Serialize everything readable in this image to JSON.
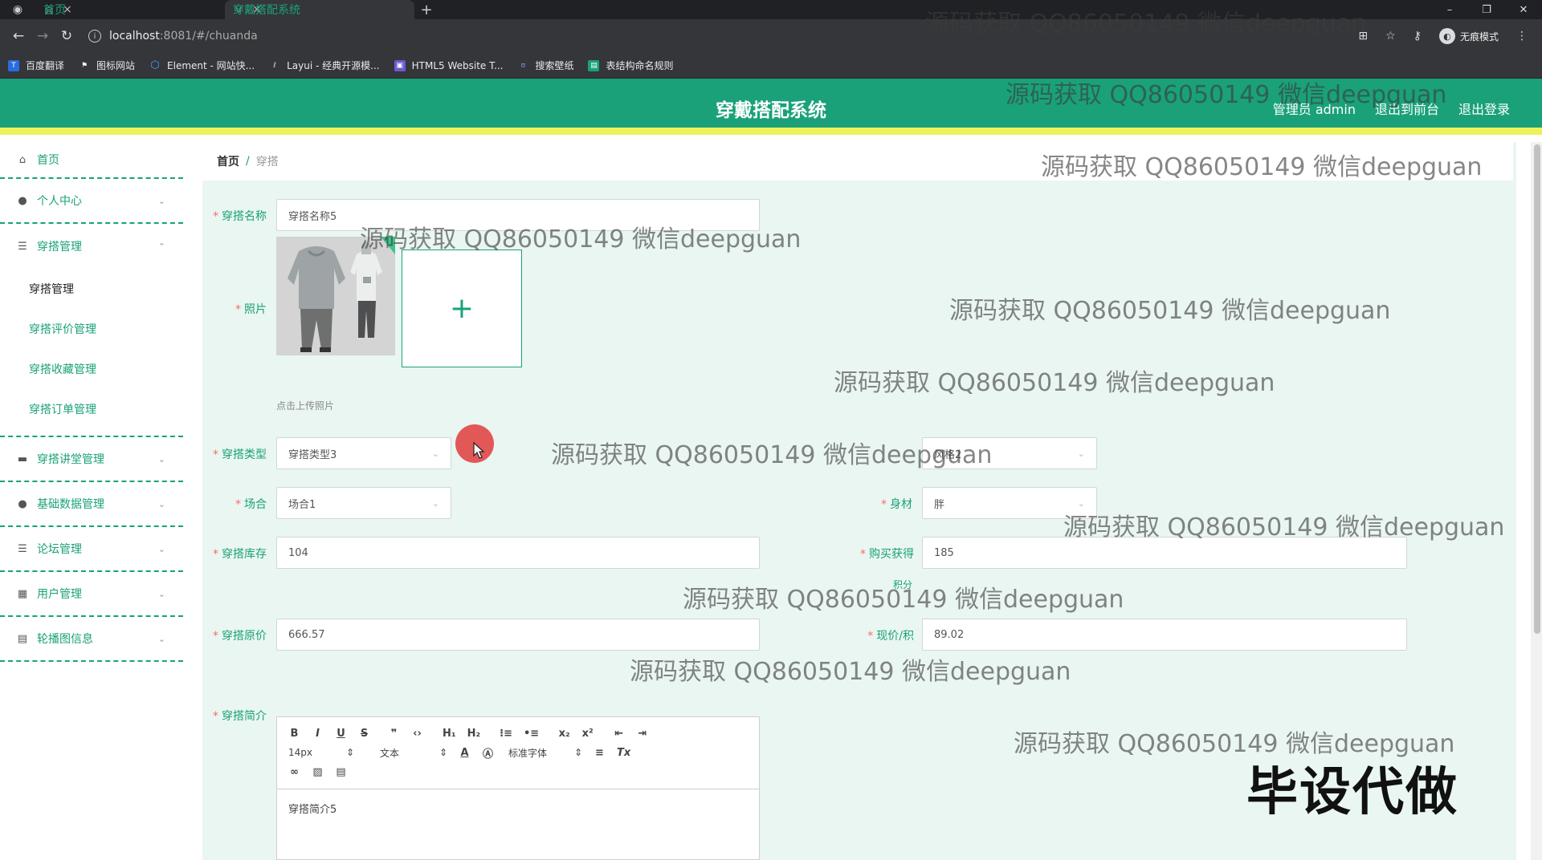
{
  "browser": {
    "tabs": [
      {
        "label": "首页",
        "active": false
      },
      {
        "label": "穿戴搭配系统",
        "active": true
      }
    ],
    "url_host": "localhost",
    "url_rest": ":8081/#/chuanda",
    "incognito_label": "无痕模式",
    "bookmarks": [
      {
        "label": "百度翻译",
        "color": "#2b6cde",
        "glyph": "T"
      },
      {
        "label": "图标网站",
        "color": "#ffffff",
        "glyph": "⚑"
      },
      {
        "label": "Element - 网站快...",
        "color": "#409eff",
        "glyph": "⬡"
      },
      {
        "label": "Layui - 经典开源模...",
        "color": "#666666",
        "glyph": "ℓ"
      },
      {
        "label": "HTML5 Website T...",
        "color": "#6b5bd2",
        "glyph": "▣"
      },
      {
        "label": "搜索壁纸",
        "color": "#3b6ed8",
        "glyph": "ʊ"
      },
      {
        "label": "表结构命名规则",
        "color": "#1aa179",
        "glyph": "▤"
      }
    ]
  },
  "header": {
    "title": "穿戴搭配系统",
    "admin_label": "管理员 admin",
    "front_link": "退出到前台",
    "logout_link": "退出登录",
    "brand_color": "#1aa179",
    "stripe_color": "#eef25a"
  },
  "sidebar": {
    "home": "首页",
    "personal": "个人中心",
    "outfit_mgmt": "穿搭管理",
    "outfit_sub": [
      "穿搭管理",
      "穿搭评价管理",
      "穿搭收藏管理",
      "穿搭订单管理"
    ],
    "others": [
      {
        "label": "穿搭讲堂管理",
        "icon": "chat-icon"
      },
      {
        "label": "基础数据管理",
        "icon": "pin-icon"
      },
      {
        "label": "论坛管理",
        "icon": "list-icon"
      },
      {
        "label": "用户管理",
        "icon": "grid-icon"
      },
      {
        "label": "轮播图信息",
        "icon": "box-icon"
      }
    ]
  },
  "breadcrumb": {
    "home": "首页",
    "sep": "/",
    "current": "穿搭"
  },
  "form": {
    "name_label": "穿搭名称",
    "name_value": "穿搭名称5",
    "photo_label": "照片",
    "upload_tip": "点击上传照片",
    "type_label": "穿搭类型",
    "type_value": "穿搭类型3",
    "style_value": "风格2",
    "occasion_label": "场合",
    "occasion_value": "场合1",
    "body_label": "身材",
    "body_value": "胖",
    "stock_label": "穿搭库存",
    "stock_value": "104",
    "points_label": "购买获得",
    "points_label2": "积分",
    "points_value": "185",
    "orig_price_label": "穿搭原价",
    "orig_price_value": "666.57",
    "cur_price_label": "现价/积",
    "cur_price_value": "89.02",
    "intro_label": "穿搭简介",
    "intro_value": "穿搭简介5"
  },
  "editor": {
    "font_size": "14px",
    "block_type": "文本",
    "font_family": "标准字体"
  },
  "watermark": {
    "text": "源码获取 QQ86050149 微信deepguan",
    "badge": "毕设代做"
  }
}
